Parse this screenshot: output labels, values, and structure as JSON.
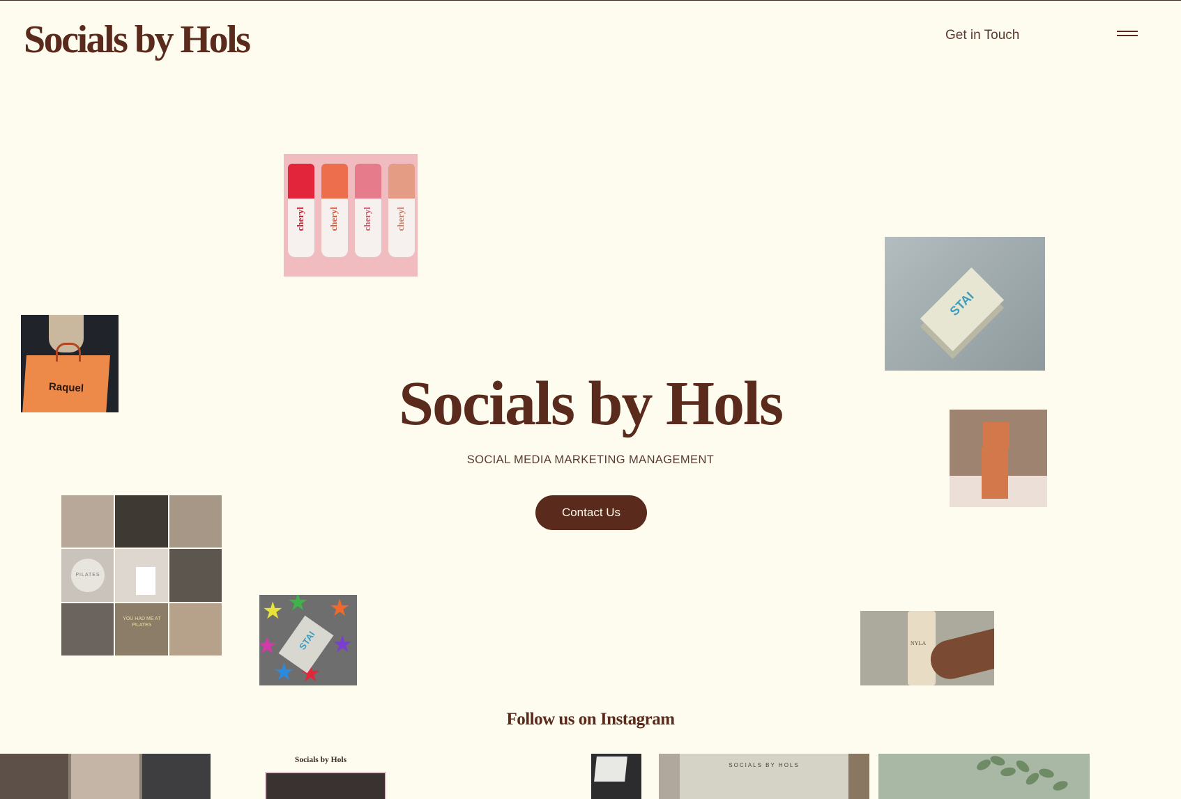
{
  "header": {
    "brand": "Socials by Hols",
    "nav_link": "Get in Touch",
    "menu_icon": "hamburger-menu-icon"
  },
  "hero": {
    "title": "Socials by Hols",
    "subtitle": "SOCIAL MEDIA MARKETING MANAGEMENT",
    "cta_label": "Contact Us"
  },
  "gallery": {
    "tube_label": "cheryl",
    "tube_colors": [
      "#e3253c",
      "#ec6e4c",
      "#e67b8c",
      "#e59c84"
    ],
    "bag_label": "Raquel",
    "box_logo": "STAI",
    "grid_plate": "PILATES",
    "grid_neon": "YOU HAD ME AT PILATES",
    "hand_brand": "NYLA"
  },
  "instagram": {
    "heading": "Follow us on Instagram",
    "post_2_title": "Socials by Hols",
    "post_4_title": "SOCIALS BY HOLS"
  },
  "colors": {
    "background": "#fefcee",
    "brand_brown": "#5a2a1c",
    "button_text": "#fefcee"
  }
}
